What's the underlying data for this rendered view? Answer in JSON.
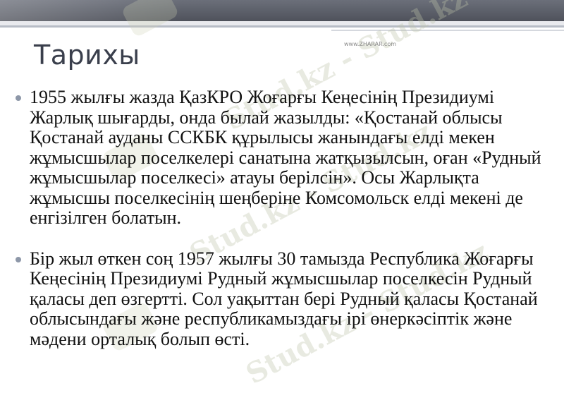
{
  "slide": {
    "title": "Тарихы",
    "credit": "www.ZHARAR.com",
    "watermark_text": "Stud.kz - Stud.kz",
    "bullets": [
      "1955 жылғы жазда ҚазКРО Жоғарғы Кеңесінің Президиумі Жарлық шығарды, онда былай жазылды: «Қостанай облысы Қостанай ауданы ССКБК құрылысы жанындағы елді мекен жұмысшылар поселкелері санатына жатқызылсын, оған «Рудный жұмысшылар поселкесі» атауы берілсін». Осы Жарлықта жұмысшы поселкесінің шеңберіне Комсомольск елді мекені де енгізілген болатын.",
      "Бір жыл өткен соң 1957 жылғы 30 тамызда Республика Жоғарғы Кеңесінің Президиумі Рудный жұмысшылар поселкесін Рудный қаласы деп өзгертті. Сол уақыттан бері Рудный қаласы Қостанай облысындағы және республикамыздағы ірі өнеркәсіптік және мәдени орталық болып өсті."
    ]
  },
  "colors": {
    "header_bar": "#4f525b",
    "title": "#3a3f4c",
    "bullet": "#8d97a8",
    "text": "#111111"
  }
}
